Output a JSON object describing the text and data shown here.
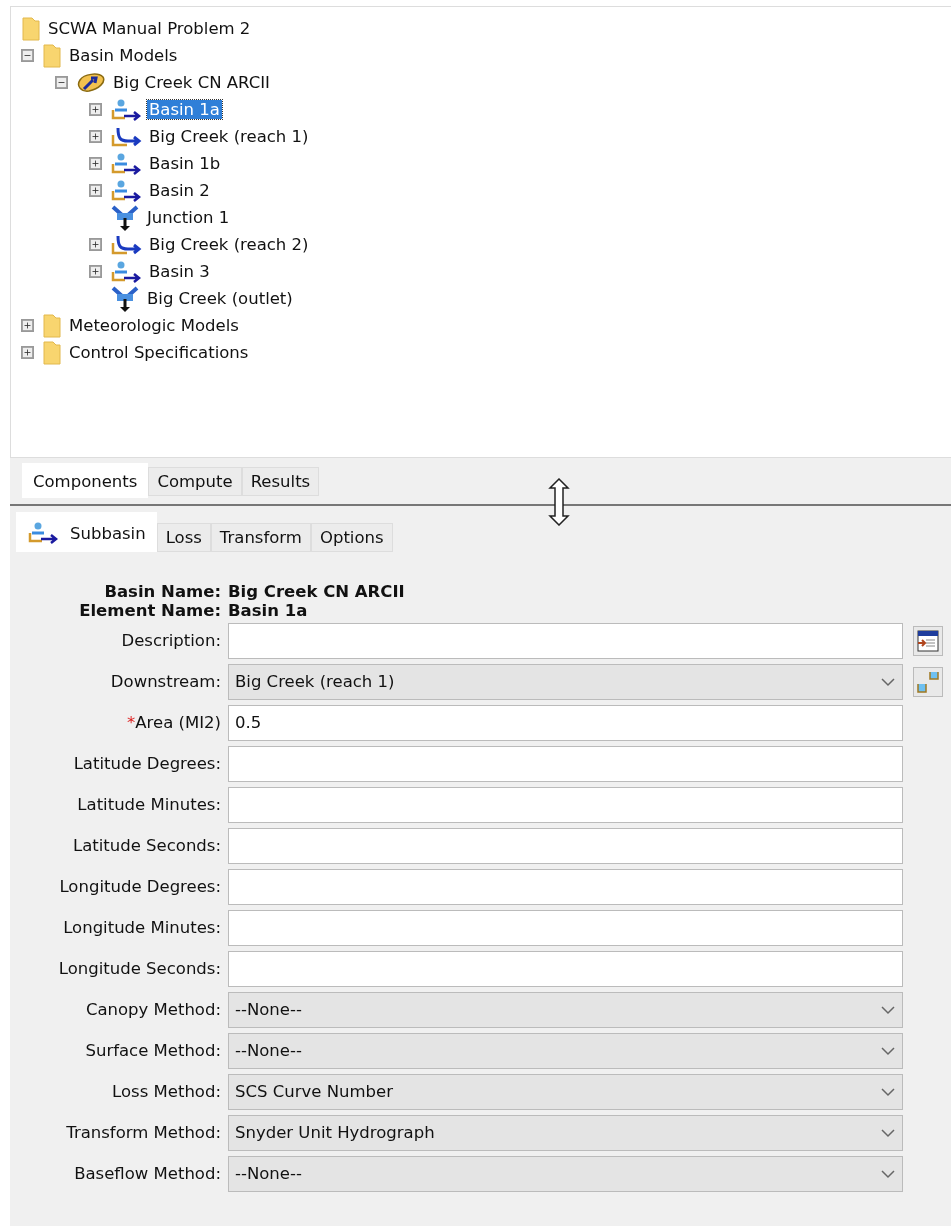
{
  "tree": [
    {
      "label": "SCWA Manual Problem 2",
      "kind": "folder",
      "selected": false,
      "children": [
        {
          "label": "Basin Models",
          "kind": "folder",
          "expanded": true,
          "selected": false,
          "children": [
            {
              "label": "Big Creek CN ARCII",
              "kind": "basin-model",
              "expanded": true,
              "selected": false,
              "children": [
                {
                  "label": "Basin 1a",
                  "kind": "subbasin",
                  "expanded": false,
                  "selected": true
                },
                {
                  "label": "Big Creek (reach 1)",
                  "kind": "reach",
                  "expanded": false,
                  "selected": false
                },
                {
                  "label": "Basin 1b",
                  "kind": "subbasin",
                  "expanded": false,
                  "selected": false
                },
                {
                  "label": "Basin 2",
                  "kind": "subbasin",
                  "expanded": false,
                  "selected": false
                },
                {
                  "label": "Junction 1",
                  "kind": "junction",
                  "selected": false
                },
                {
                  "label": "Big Creek (reach 2)",
                  "kind": "reach",
                  "expanded": false,
                  "selected": false
                },
                {
                  "label": "Basin 3",
                  "kind": "subbasin",
                  "expanded": false,
                  "selected": false
                },
                {
                  "label": "Big Creek (outlet)",
                  "kind": "junction",
                  "selected": false
                }
              ]
            }
          ]
        },
        {
          "label": "Meteorologic Models",
          "kind": "folder",
          "expanded": false,
          "selected": false
        },
        {
          "label": "Control Specifications",
          "kind": "folder",
          "expanded": false,
          "selected": false
        }
      ]
    }
  ],
  "top_tabs": [
    {
      "label": "Components",
      "selected": true
    },
    {
      "label": "Compute",
      "selected": false
    },
    {
      "label": "Results",
      "selected": false
    }
  ],
  "editor_tabs": [
    {
      "label": "Subbasin",
      "kind": "subbasin",
      "selected": true
    },
    {
      "label": "Loss",
      "kind": "plain",
      "selected": false
    },
    {
      "label": "Transform",
      "kind": "plain",
      "selected": false
    },
    {
      "label": "Options",
      "kind": "plain",
      "selected": false
    }
  ],
  "header": [
    {
      "label": "Basin Name:",
      "value": "Big Creek CN ARCII"
    },
    {
      "label": "Element Name:",
      "value": "Basin 1a"
    }
  ],
  "fields": [
    {
      "label": "Description:",
      "kind": "text",
      "side_button": {
        "kind": "notes"
      }
    },
    {
      "label": "Downstream:",
      "kind": "select",
      "value": "Big Creek (reach 1)",
      "side_button": {
        "kind": "basins"
      }
    },
    {
      "required_mark": "*",
      "label": "Area (MI2)",
      "kind": "text",
      "value": "0.5"
    },
    {
      "label": "Latitude Degrees:",
      "kind": "text"
    },
    {
      "label": "Latitude Minutes:",
      "kind": "text"
    },
    {
      "label": "Latitude Seconds:",
      "kind": "text"
    },
    {
      "label": "Longitude Degrees:",
      "kind": "text"
    },
    {
      "label": "Longitude Minutes:",
      "kind": "text"
    },
    {
      "label": "Longitude Seconds:",
      "kind": "text"
    },
    {
      "label": "Canopy Method:",
      "kind": "select",
      "value": "--None--"
    },
    {
      "label": "Surface Method:",
      "kind": "select",
      "value": "--None--"
    },
    {
      "label": "Loss Method:",
      "kind": "select",
      "value": "SCS Curve Number"
    },
    {
      "label": "Transform Method:",
      "kind": "select",
      "value": "Snyder Unit Hydrograph"
    },
    {
      "label": "Baseflow Method:",
      "kind": "select",
      "value": "--None--"
    }
  ]
}
